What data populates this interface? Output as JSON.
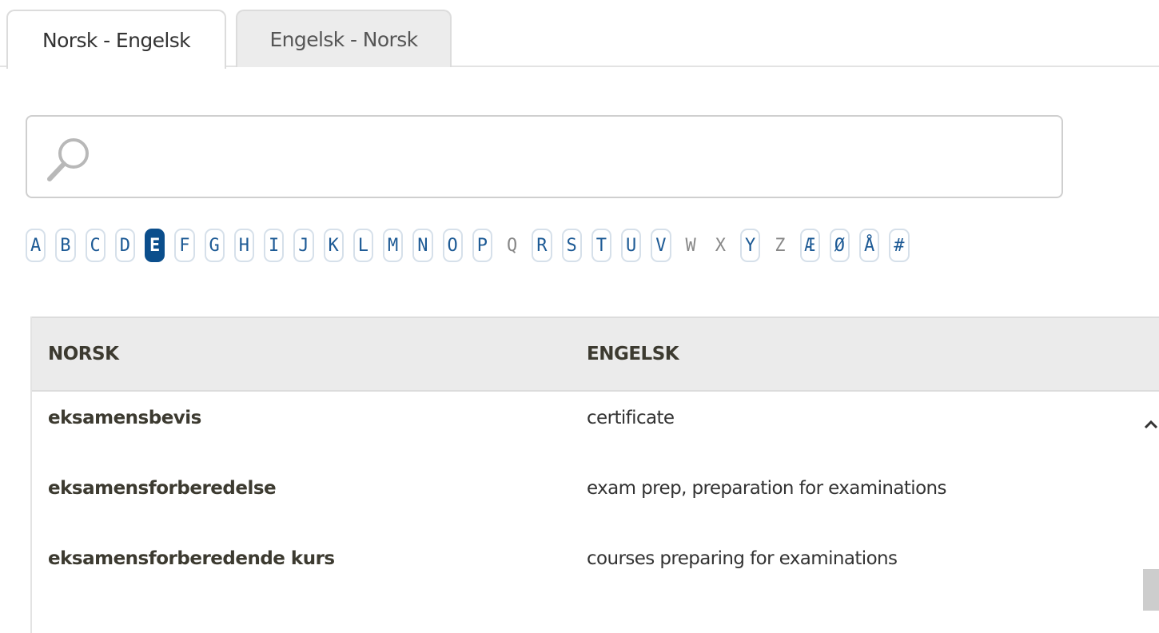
{
  "tabs": [
    {
      "label": "Norsk - Engelsk",
      "active": true
    },
    {
      "label": "Engelsk - Norsk",
      "active": false
    }
  ],
  "search": {
    "value": "",
    "placeholder": "",
    "icon": "search-icon"
  },
  "alphabet": {
    "selected": "E",
    "letters": [
      {
        "char": "A",
        "enabled": true
      },
      {
        "char": "B",
        "enabled": true
      },
      {
        "char": "C",
        "enabled": true
      },
      {
        "char": "D",
        "enabled": true
      },
      {
        "char": "E",
        "enabled": true
      },
      {
        "char": "F",
        "enabled": true
      },
      {
        "char": "G",
        "enabled": true
      },
      {
        "char": "H",
        "enabled": true
      },
      {
        "char": "I",
        "enabled": true
      },
      {
        "char": "J",
        "enabled": true
      },
      {
        "char": "K",
        "enabled": true
      },
      {
        "char": "L",
        "enabled": true
      },
      {
        "char": "M",
        "enabled": true
      },
      {
        "char": "N",
        "enabled": true
      },
      {
        "char": "O",
        "enabled": true
      },
      {
        "char": "P",
        "enabled": true
      },
      {
        "char": "Q",
        "enabled": false
      },
      {
        "char": "R",
        "enabled": true
      },
      {
        "char": "S",
        "enabled": true
      },
      {
        "char": "T",
        "enabled": true
      },
      {
        "char": "U",
        "enabled": true
      },
      {
        "char": "V",
        "enabled": true
      },
      {
        "char": "W",
        "enabled": false
      },
      {
        "char": "X",
        "enabled": false
      },
      {
        "char": "Y",
        "enabled": true
      },
      {
        "char": "Z",
        "enabled": false
      },
      {
        "char": "Æ",
        "enabled": true
      },
      {
        "char": "Ø",
        "enabled": true
      },
      {
        "char": "Å",
        "enabled": true
      },
      {
        "char": "#",
        "enabled": true
      }
    ]
  },
  "table": {
    "headers": {
      "norsk": "NORSK",
      "engelsk": "ENGELSK"
    },
    "rows": [
      {
        "norsk": "eksamensbevis",
        "engelsk": "certificate"
      },
      {
        "norsk": "eksamensforberedelse",
        "engelsk": "exam prep, preparation for examinations"
      },
      {
        "norsk": "eksamensforberedende kurs",
        "engelsk": "courses preparing for examinations"
      }
    ]
  },
  "scrollbar": {
    "up_icon": "chevron-up-icon"
  },
  "colors": {
    "accent": "#0b4e8c",
    "letter_text": "#1d5a95",
    "header_bg": "#ebebeb",
    "term_text": "#3c3a30"
  }
}
